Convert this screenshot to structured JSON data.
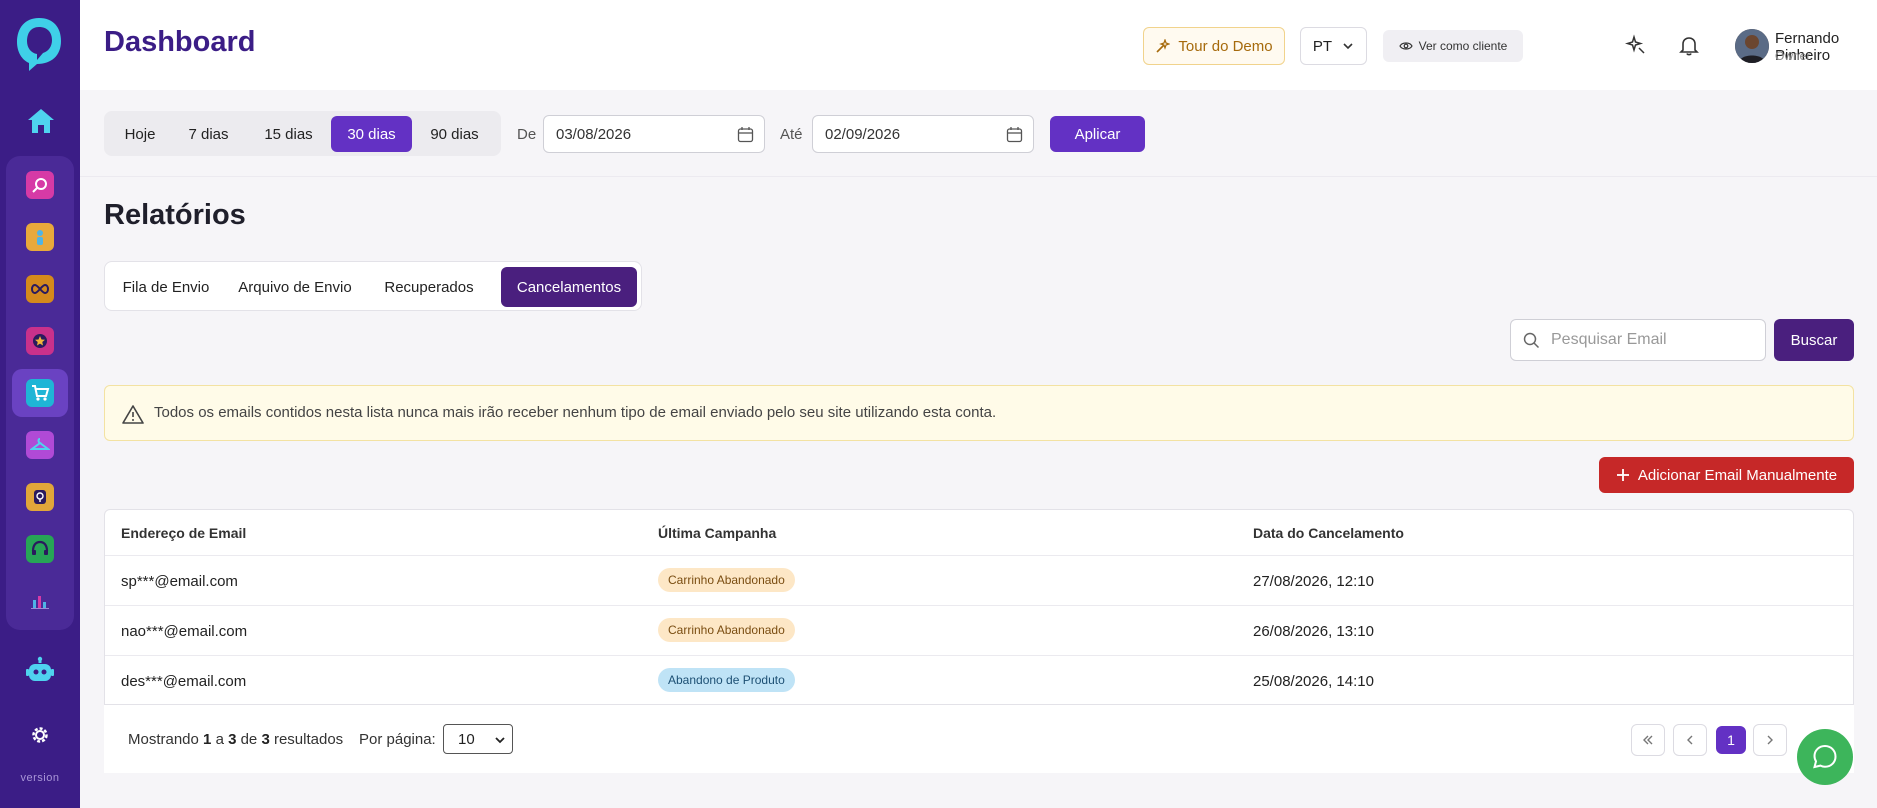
{
  "sidebar": {
    "version": "version",
    "items": [
      {
        "icon": "search-chat-icon",
        "color": "#d63aa6"
      },
      {
        "icon": "person-icon",
        "color": "#e9a93b"
      },
      {
        "icon": "infinity-icon",
        "color": "#d58a1c"
      },
      {
        "icon": "star-badge-icon",
        "color": "#c9318b"
      },
      {
        "icon": "cart-icon",
        "color": "#1fb5d6"
      },
      {
        "icon": "hanger-icon",
        "color": "#b04ad6"
      },
      {
        "icon": "lightbulb-icon",
        "color": "#e1a63a"
      },
      {
        "icon": "headset-icon",
        "color": "#27a556"
      },
      {
        "icon": "bar-chart-icon",
        "color": "#4a2a97"
      }
    ]
  },
  "header": {
    "title": "Dashboard",
    "tour_label": "Tour do Demo",
    "language": "PT",
    "view_client_label": "Ver como cliente",
    "user_name": "Fernando Pinheiro",
    "user_role": "Owner"
  },
  "filters": {
    "periods": [
      "Hoje",
      "7 dias",
      "15 dias",
      "30 dias",
      "90 dias"
    ],
    "active_period": "30 dias",
    "from_label": "De",
    "from_value": "03/08/2026",
    "to_label": "Até",
    "to_value": "02/09/2026",
    "apply_label": "Aplicar"
  },
  "reports": {
    "title": "Relatórios",
    "tabs": [
      "Fila de Envio",
      "Arquivo de Envio",
      "Recuperados",
      "Cancelamentos"
    ],
    "active_tab": "Cancelamentos",
    "search_placeholder": "Pesquisar Email",
    "search_button": "Buscar",
    "warning": "Todos os emails contidos nesta lista nunca mais irão receber nenhum tipo de email enviado pelo seu site utilizando esta conta.",
    "add_button": "Adicionar Email Manualmente"
  },
  "table": {
    "columns": [
      "Endereço de Email",
      "Última Campanha",
      "Data do Cancelamento"
    ],
    "rows": [
      {
        "email": "sp***@email.com",
        "campaign": "Carrinho Abandonado",
        "campaign_color": "orange",
        "date": "27/08/2026, 12:10"
      },
      {
        "email": "nao***@email.com",
        "campaign": "Carrinho Abandonado",
        "campaign_color": "orange",
        "date": "26/08/2026, 13:10"
      },
      {
        "email": "des***@email.com",
        "campaign": "Abandono de Produto",
        "campaign_color": "blue",
        "date": "25/08/2026, 14:10"
      }
    ]
  },
  "pagination": {
    "showing_prefix": "Mostrando",
    "from": "1",
    "between": "a",
    "to": "3",
    "of": "de",
    "total": "3",
    "suffix": "resultados",
    "per_page_label": "Por página:",
    "per_page_value": "10",
    "current_page": "1"
  },
  "colors": {
    "sidebar_bg": "#3b1d86",
    "primary": "#6331c4",
    "dark_primary": "#4a1f7e",
    "danger": "#c62828",
    "whatsapp": "#3db55b"
  }
}
